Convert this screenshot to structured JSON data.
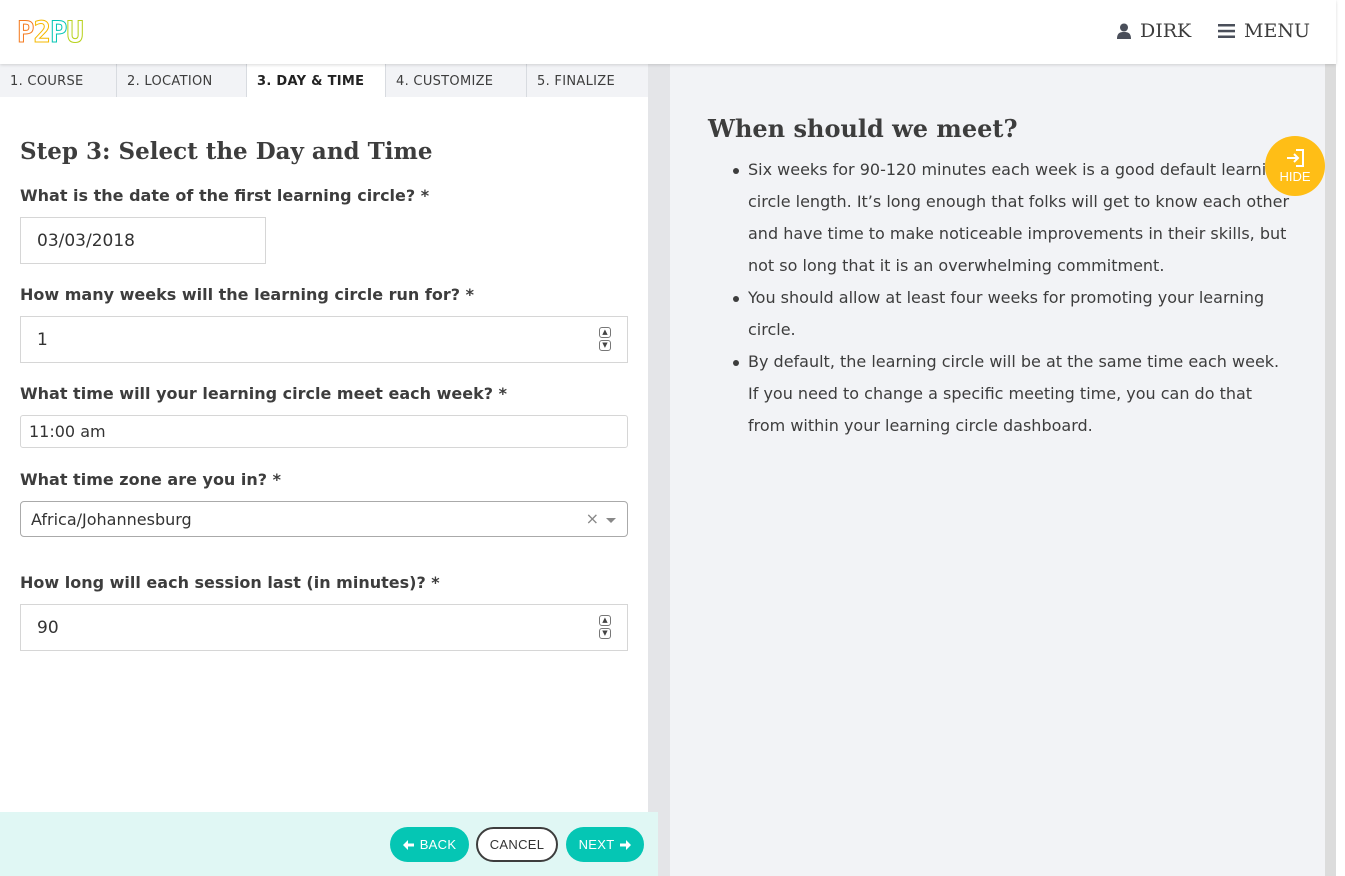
{
  "header": {
    "logo": [
      "P",
      "2",
      "P",
      "U"
    ],
    "user_name": "DIRK",
    "menu_label": "MENU"
  },
  "tabs": [
    {
      "label": "1. COURSE",
      "active": false
    },
    {
      "label": "2. LOCATION",
      "active": false
    },
    {
      "label": "3. DAY & TIME",
      "active": true
    },
    {
      "label": "4. CUSTOMIZE",
      "active": false
    },
    {
      "label": "5. FINALIZE",
      "active": false
    }
  ],
  "form": {
    "title": "Step 3: Select the Day and Time",
    "date_label": "What is the date of the first learning circle? *",
    "date_value": "03/03/2018",
    "weeks_label": "How many weeks will the learning circle run for? *",
    "weeks_value": "1",
    "time_label": "What time will your learning circle meet each week? *",
    "time_value": "11:00 am",
    "timezone_label": "What time zone are you in? *",
    "timezone_value": "Africa/Johannesburg",
    "duration_label": "How long will each session last (in minutes)? *",
    "duration_value": "90"
  },
  "footer": {
    "back_label": "BACK",
    "cancel_label": "CANCEL",
    "next_label": "NEXT"
  },
  "help": {
    "title": "When should we meet?",
    "hide_label": "HIDE",
    "items": [
      "Six weeks for 90-120 minutes each week is a good default learning circle length. It’s long enough that folks will get to know each other and have time to make noticeable improvements in their skills, but not so long that it is an overwhelming commitment.",
      "You should allow at least four weeks for promoting your learning circle.",
      "By default, the learning circle will be at the same time each week. If you need to change a specific meeting time, you can do that from within your learning circle dashboard."
    ]
  },
  "colors": {
    "teal": "#05c6b4",
    "yellow": "#ffbe16",
    "panel_bg": "#f2f3f6"
  }
}
